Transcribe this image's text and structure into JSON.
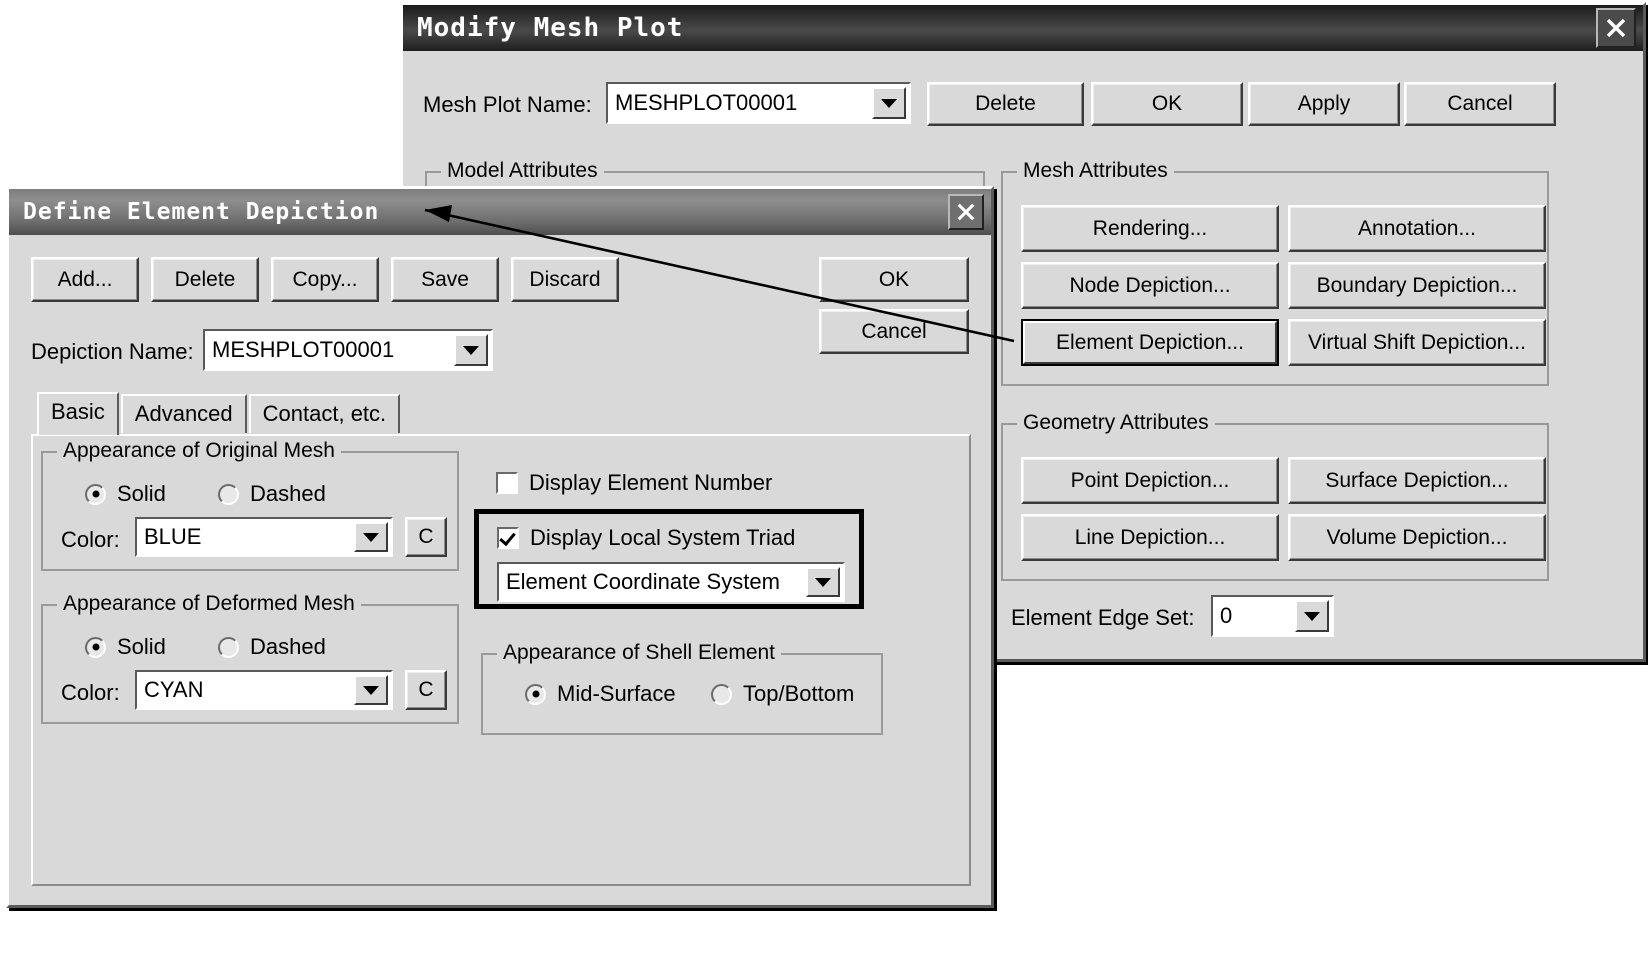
{
  "modify_mesh_plot": {
    "title": "Modify Mesh Plot",
    "close_label": "×",
    "mesh_plot_name_label": "Mesh Plot Name:",
    "mesh_plot_name_value": "MESHPLOT00001",
    "top_buttons": [
      {
        "label": "Delete"
      },
      {
        "label": "OK"
      },
      {
        "label": "Apply"
      },
      {
        "label": "Cancel"
      }
    ],
    "model_attributes_label": "Model Attributes",
    "mesh_attributes": {
      "label": "Mesh Attributes",
      "buttons": [
        {
          "label": "Rendering..."
        },
        {
          "label": "Annotation..."
        },
        {
          "label": "Node Depiction..."
        },
        {
          "label": "Boundary Depiction..."
        },
        {
          "label": "Element Depiction..."
        },
        {
          "label": "Virtual Shift Depiction..."
        }
      ]
    },
    "geometry_attributes": {
      "label": "Geometry Attributes",
      "buttons": [
        {
          "label": "Point Depiction..."
        },
        {
          "label": "Surface Depiction..."
        },
        {
          "label": "Line Depiction..."
        },
        {
          "label": "Volume Depiction..."
        }
      ]
    },
    "element_edge_set_label": "Element Edge Set:",
    "element_edge_set_value": "0"
  },
  "define_element_depiction": {
    "title": "Define Element Depiction",
    "close_label": "×",
    "toolbar": [
      {
        "label": "Add..."
      },
      {
        "label": "Delete"
      },
      {
        "label": "Copy..."
      },
      {
        "label": "Save"
      },
      {
        "label": "Discard"
      }
    ],
    "ok_label": "OK",
    "cancel_label": "Cancel",
    "depiction_name_label": "Depiction Name:",
    "depiction_name_value": "MESHPLOT00001",
    "tabs": [
      {
        "label": "Basic",
        "active": true
      },
      {
        "label": "Advanced",
        "active": false
      },
      {
        "label": "Contact, etc.",
        "active": false
      }
    ],
    "original_mesh": {
      "group_label": "Appearance of Original Mesh",
      "solid_label": "Solid",
      "dashed_label": "Dashed",
      "selected": "Solid",
      "color_label": "Color:",
      "color_value": "BLUE",
      "color_button_label": "C"
    },
    "deformed_mesh": {
      "group_label": "Appearance of Deformed Mesh",
      "solid_label": "Solid",
      "dashed_label": "Dashed",
      "selected": "Solid",
      "color_label": "Color:",
      "color_value": "CYAN",
      "color_button_label": "C"
    },
    "display_element_number": {
      "label": "Display Element Number",
      "checked": false
    },
    "display_local_system_triad": {
      "label": "Display Local System Triad",
      "checked": true,
      "coordinate_system_value": "Element Coordinate System"
    },
    "shell_element": {
      "group_label": "Appearance of Shell Element",
      "mid_surface_label": "Mid-Surface",
      "top_bottom_label": "Top/Bottom",
      "selected": "Mid-Surface"
    }
  }
}
